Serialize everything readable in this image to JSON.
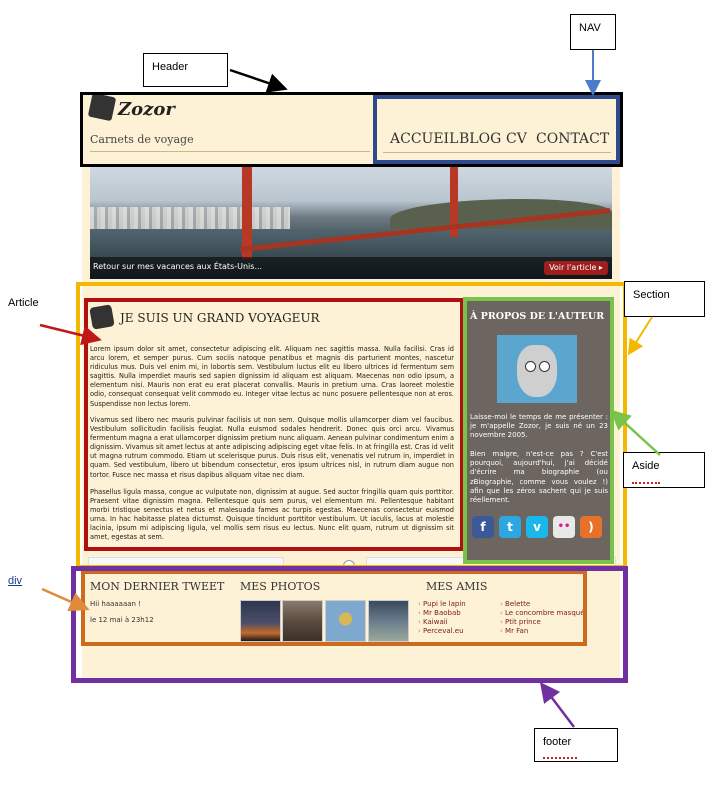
{
  "header": {
    "logo_name": "Zozor",
    "tagline": "Carnets de voyage"
  },
  "nav": {
    "items": [
      "ACCUEIL",
      "BLOG",
      "CV",
      "CONTACT"
    ]
  },
  "banner": {
    "caption": "Retour sur mes vacances aux États-Unis...",
    "button_label": "Voir l'article ▸"
  },
  "article": {
    "title": "JE SUIS UN GRAND VOYAGEUR",
    "paragraphs": [
      "Lorem ipsum dolor sit amet, consectetur adipiscing elit. Aliquam nec sagittis massa. Nulla facilisi. Cras id arcu lorem, et semper purus. Cum sociis natoque penatibus et magnis dis parturient montes, nascetur ridiculus mus. Duis vel enim mi, in lobortis sem. Vestibulum luctus elit eu libero ultrices id fermentum sem sagittis. Nulla imperdiet mauris sed sapien dignissim id aliquam est aliquam. Maecenas non odio ipsum, a elementum nisi. Mauris non erat eu erat placerat convallis. Mauris in pretium urna. Cras laoreet molestie odio, consequat consequat velit commodo eu. Integer vitae lectus ac nunc posuere pellentesque non at eros. Suspendisse non lectus lorem.",
      "Vivamus sed libero nec mauris pulvinar facilisis ut non sem. Quisque mollis ullamcorper diam vel faucibus. Vestibulum sollicitudin facilisis feugiat. Nulla euismod sodales hendrerit. Donec quis orci arcu. Vivamus fermentum magna a erat ullamcorper dignissim pretium nunc aliquam. Aenean pulvinar condimentum enim a dignissim. Vivamus sit amet lectus at ante adipiscing adipiscing eget vitae felis. In at fringilla est. Cras id velit ut magna rutrum commodo. Etiam ut scelerisque purus. Duis risus elit, venenatis vel rutrum in, imperdiet in quam. Sed vestibulum, libero ut bibendum consectetur, eros ipsum ultrices nisl, in rutrum diam augue non tortor. Fusce nec massa et risus dapibus aliquam vitae nec diam.",
      "Phasellus ligula massa, congue ac vulputate non, dignissim at augue. Sed auctor fringilla quam quis porttitor. Praesent vitae dignissim magna. Pellentesque quis sem purus, vel elementum mi. Pellentesque habitant morbi tristique senectus et netus et malesuada fames ac turpis egestas. Maecenas consectetur euismod urna. In hac habitasse platea dictumst. Quisque tincidunt porttitor vestibulum. Ut iaculis, lacus at molestie lacinia, ipsum mi adipiscing ligula, vel mollis sem risus eu lectus. Nunc elit quam, rutrum ut dignissim sit amet, egestas at sem."
    ]
  },
  "aside": {
    "title": "À PROPOS DE L'AUTEUR",
    "paragraphs": [
      "Laisse-moi le temps de me présenter : je m'appelle Zozor, je suis né un 23 novembre 2005.",
      "Bien maigre, n'est-ce pas ? C'est pourquoi, aujourd'hui, j'ai décidé d'écrire ma biographie (ou zBiographie, comme vous voulez !) afin que les zéros sachent qui je suis réellement."
    ],
    "social": [
      {
        "icon": "facebook-icon",
        "glyph": "f",
        "color": "#3b5998"
      },
      {
        "icon": "twitter-icon",
        "glyph": "t",
        "color": "#2ea7e0"
      },
      {
        "icon": "vimeo-icon",
        "glyph": "v",
        "color": "#1ab7ea"
      },
      {
        "icon": "flickr-icon",
        "glyph": "••",
        "color": "#e8e8e8"
      },
      {
        "icon": "rss-icon",
        "glyph": ")",
        "color": "#e8712a"
      }
    ]
  },
  "footer": {
    "tweet": {
      "heading": "MON DERNIER TWEET",
      "text": "Hii haaaaaan !",
      "date": "le 12 mai à 23h12"
    },
    "photos": {
      "heading": "MES PHOTOS"
    },
    "friends": {
      "heading": "MES AMIS",
      "col1": [
        "Pupi le lapin",
        "Mr Baobab",
        "Kaiwaii",
        "Perceval.eu"
      ],
      "col2": [
        "Belette",
        "Le concombre masqué",
        "Ptit prince",
        "Mr Fan"
      ]
    }
  },
  "annotations": {
    "header": "Header",
    "nav": "NAV",
    "article": "Article",
    "section": "Section",
    "aside": "Aside",
    "div": "div",
    "footer": "footer"
  },
  "colors": {
    "header_box": "#000000",
    "nav_box": "#2e4a8c",
    "section_box": "#f5b800",
    "article_box": "#b01010",
    "aside_box": "#78c44a",
    "div_box": "#cc6a1e",
    "footer_box": "#7030a0",
    "page_bg": "#fdf2d5"
  }
}
